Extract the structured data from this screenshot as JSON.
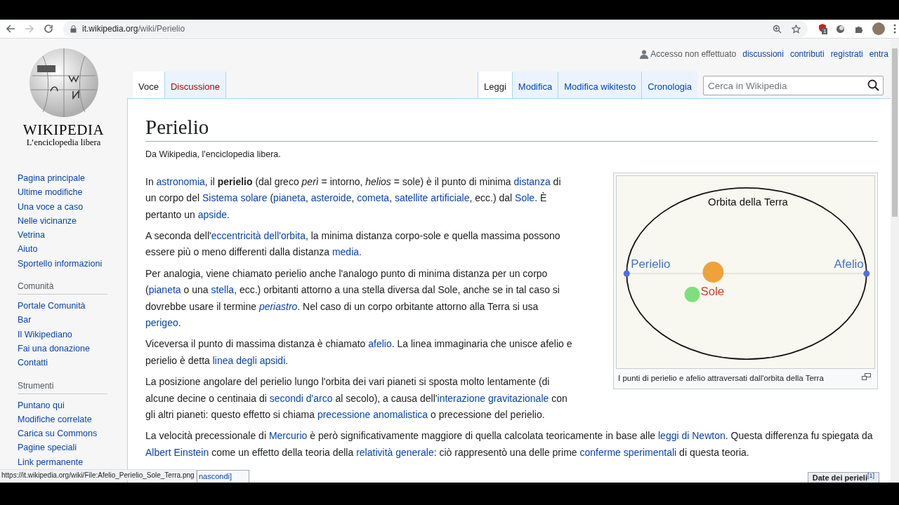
{
  "browser": {
    "url_domain": "it.wikipedia.org",
    "url_path": "/wiki/Perielio",
    "extension_badge": "1"
  },
  "logo": {
    "wordmark": "WIKIPEDIA",
    "tagline": "L’enciclopedia libera"
  },
  "sidebar": [
    {
      "items": [
        "Pagina principale",
        "Ultime modifiche",
        "Una voce a caso",
        "Nelle vicinanze",
        "Vetrina",
        "Aiuto",
        "Sportello informazioni"
      ]
    },
    {
      "heading": "Comunità",
      "items": [
        "Portale Comunità",
        "Bar",
        "Il Wikipediano",
        "Fai una donazione",
        "Contatti"
      ]
    },
    {
      "heading": "Strumenti",
      "items": [
        "Puntano qui",
        "Modifiche correlate",
        "Carica su Commons",
        "Pagine speciali",
        "Link permanente"
      ]
    }
  ],
  "personal_tools": {
    "status": "Accesso non effettuato",
    "links": [
      "discussioni",
      "contributi",
      "registrati",
      "entra"
    ]
  },
  "namespace_tabs": [
    {
      "label": "Voce",
      "selected": true,
      "missing": false
    },
    {
      "label": "Discussione",
      "selected": false,
      "missing": true
    }
  ],
  "view_tabs": [
    {
      "label": "Leggi",
      "selected": true
    },
    {
      "label": "Modifica",
      "selected": false
    },
    {
      "label": "Modifica wikitesto",
      "selected": false
    },
    {
      "label": "Cronologia",
      "selected": false
    }
  ],
  "search": {
    "placeholder": "Cerca in Wikipedia"
  },
  "article": {
    "title": "Perielio",
    "tagline": "Da Wikipedia, l'enciclopedia libera.",
    "figure": {
      "orbit_label": "Orbita della Terra",
      "perihelion_label": "Perielio",
      "aphelion_label": "Afelio",
      "sun_label": "Sole",
      "caption": "I punti di perielio e afelio attraversati dall'orbita della Terra"
    },
    "paragraphs": [
      [
        {
          "kind": "text",
          "text": "In "
        },
        {
          "kind": "link",
          "text": "astronomia"
        },
        {
          "kind": "text",
          "text": ", il **perielio** (dal greco *perì* = intorno, *helios* = sole) è il punto di minima "
        },
        {
          "kind": "link",
          "text": "distanza"
        },
        {
          "kind": "text",
          "text": " di un corpo del "
        },
        {
          "kind": "link",
          "text": "Sistema solare"
        },
        {
          "kind": "text",
          "text": " ("
        },
        {
          "kind": "link",
          "text": "pianeta"
        },
        {
          "kind": "text",
          "text": ", "
        },
        {
          "kind": "link",
          "text": "asteroide"
        },
        {
          "kind": "text",
          "text": ", "
        },
        {
          "kind": "link",
          "text": "cometa"
        },
        {
          "kind": "text",
          "text": ", "
        },
        {
          "kind": "link",
          "text": "satellite artificiale"
        },
        {
          "kind": "text",
          "text": ", ecc.) dal "
        },
        {
          "kind": "link",
          "text": "Sole"
        },
        {
          "kind": "text",
          "text": ". È pertanto un "
        },
        {
          "kind": "link",
          "text": "apside"
        },
        {
          "kind": "text",
          "text": "."
        }
      ],
      [
        {
          "kind": "text",
          "text": "A seconda dell'"
        },
        {
          "kind": "link",
          "text": "eccentricità dell'orbita"
        },
        {
          "kind": "text",
          "text": ", la minima distanza corpo-sole e quella massima possono essere più o meno differenti dalla distanza "
        },
        {
          "kind": "link",
          "text": "media"
        },
        {
          "kind": "text",
          "text": "."
        }
      ],
      [
        {
          "kind": "text",
          "text": "Per analogia, viene chiamato perielio anche l'analogo punto di minima distanza per un corpo ("
        },
        {
          "kind": "link",
          "text": "pianeta"
        },
        {
          "kind": "text",
          "text": " o una "
        },
        {
          "kind": "link",
          "text": "stella"
        },
        {
          "kind": "text",
          "text": ", ecc.) orbitanti attorno a una stella diversa dal Sole, anche se in tal caso si dovrebbe usare il termine "
        },
        {
          "kind": "link",
          "text": "*periastro*"
        },
        {
          "kind": "text",
          "text": ". Nel caso di un corpo orbitante attorno alla Terra si usa "
        },
        {
          "kind": "link",
          "text": "perigeo"
        },
        {
          "kind": "text",
          "text": "."
        }
      ],
      [
        {
          "kind": "text",
          "text": "Viceversa il punto di massima distanza è chiamato "
        },
        {
          "kind": "link",
          "text": "afelio"
        },
        {
          "kind": "text",
          "text": ". La linea immaginaria che unisce afelio e perielio è detta "
        },
        {
          "kind": "link",
          "text": "linea degli apsidi"
        },
        {
          "kind": "text",
          "text": "."
        }
      ],
      [
        {
          "kind": "text",
          "text": "La posizione angolare del perielio lungo l'orbita dei vari pianeti si sposta molto lentamente (di alcune decine o centinaia di "
        },
        {
          "kind": "link",
          "text": "secondi d'arco"
        },
        {
          "kind": "text",
          "text": " al secolo), a causa dell'"
        },
        {
          "kind": "link",
          "text": "interazione gravitazionale"
        },
        {
          "kind": "text",
          "text": " con gli altri pianeti: questo effetto si chiama "
        },
        {
          "kind": "link",
          "text": "precessione anomalistica"
        },
        {
          "kind": "text",
          "text": " o precessione del perielio."
        }
      ],
      [
        {
          "kind": "text",
          "text": "La velocità precessionale di "
        },
        {
          "kind": "link",
          "text": "Mercurio"
        },
        {
          "kind": "text",
          "text": " è però significativamente maggiore di quella calcolata teoricamente in base alle "
        },
        {
          "kind": "link",
          "text": "leggi di Newton"
        },
        {
          "kind": "text",
          "text": ". Questa differenza fu spiegata da "
        },
        {
          "kind": "link",
          "text": "Albert Einstein"
        },
        {
          "kind": "text",
          "text": " come un effetto della teoria della "
        },
        {
          "kind": "link",
          "text": "relatività generale"
        },
        {
          "kind": "text",
          "text": ": ciò rappresentò una delle prime "
        },
        {
          "kind": "link",
          "text": "conferme sperimentali"
        },
        {
          "kind": "text",
          "text": " di questa teoria."
        }
      ]
    ],
    "toc_toggle": "nascondi]",
    "table_caption": "Date dei perieli",
    "table_caption_ref": "[1]"
  },
  "status_bar": "https://it.wikipedia.org/wiki/File:Afelio_Perielio_Sole_Terra.png"
}
